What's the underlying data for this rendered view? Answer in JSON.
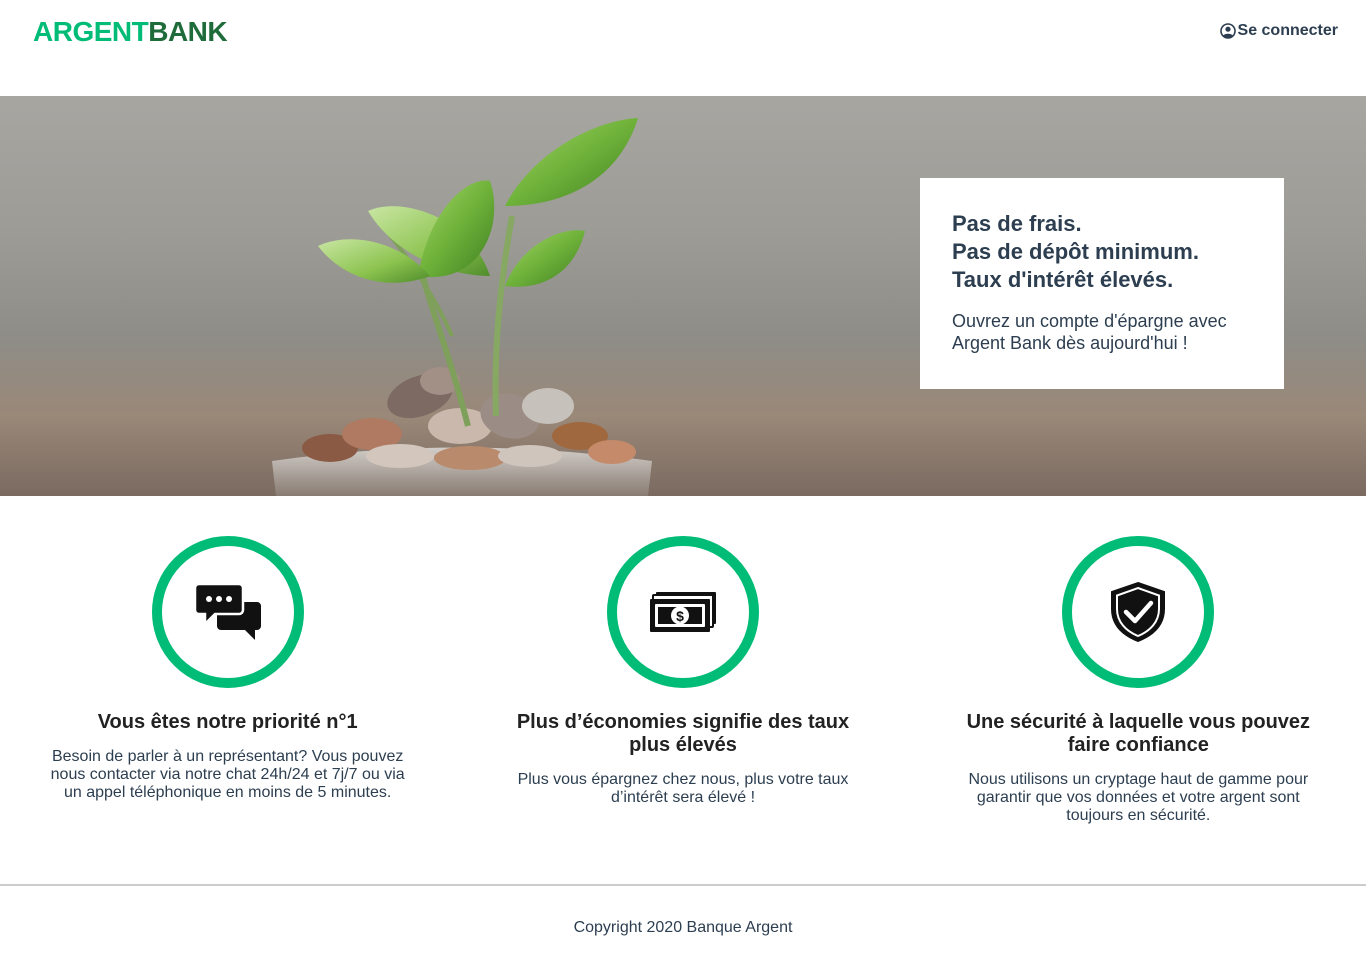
{
  "nav": {
    "logo_part1": "ARGENT",
    "logo_part2": "BANK",
    "signin_label": "Se connecter",
    "signin_icon": "user-circle-icon"
  },
  "hero": {
    "subtitles": [
      "Pas de frais.",
      "Pas de dépôt minimum.",
      "Taux d'intérêt élevés."
    ],
    "text": "Ouvrez un compte d'épargne avec Argent Bank dès aujourd'hui !"
  },
  "features": [
    {
      "icon": "chat-icon",
      "title": "Vous êtes notre priorité n°1",
      "text": "Besoin de parler à un représentant? Vous pouvez nous contacter via notre chat 24h/24 et 7j/7 ou via un appel téléphonique en moins de 5 minutes."
    },
    {
      "icon": "money-icon",
      "title": "Plus d’économies signifie des taux plus élevés",
      "text": "Plus vous épargnez chez nous, plus votre taux d’intérêt sera élevé !"
    },
    {
      "icon": "security-icon",
      "title": "Une sécurité à laquelle vous pouvez faire confiance",
      "text": "Nous utilisons un cryptage haut de gamme pour garantir que vos données et votre argent sont toujours en sécurité."
    }
  ],
  "footer": {
    "copyright": "Copyright 2020 Banque Argent"
  },
  "colors": {
    "accent": "#00bc77",
    "logo_dark": "#1f6b3a",
    "text": "#2c3e50"
  }
}
